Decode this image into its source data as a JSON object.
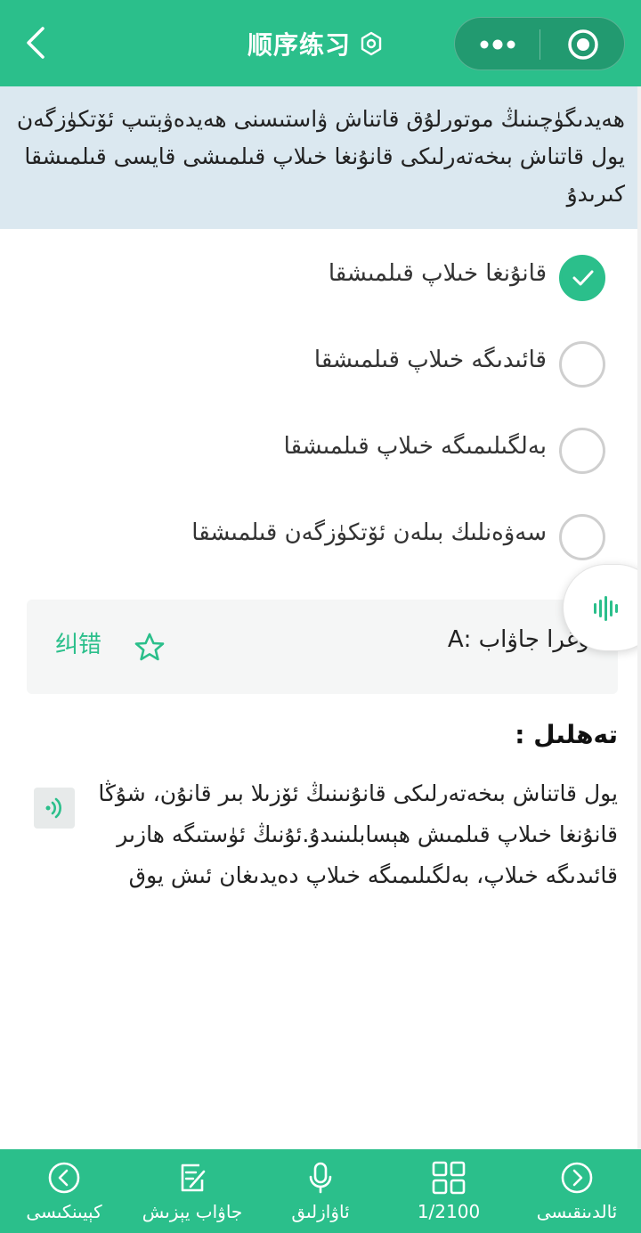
{
  "header": {
    "title": "顺序练习",
    "icons": {
      "back": "chevron-left-icon",
      "settings": "hexagon-gear-icon",
      "more": "more-dots-icon",
      "close": "target-circle-icon"
    }
  },
  "question": {
    "text": "ھەيدىگۈچىنىڭ موتورلۇق قاتناش ۋاستىسنى ھەيدەۋېتىپ ئۆتكۈزگەن يول قاتناش بىخەتەرلىكى قانۇنغا خىلاپ قىلمىشى قايسى قىلمىشقا كىرىدۇ"
  },
  "options": [
    {
      "label": "قانۇنغا خىلاپ قىلمىشقا",
      "checked": true
    },
    {
      "label": "قائىدىگە خىلاپ قىلمىشقا",
      "checked": false
    },
    {
      "label": "بەلگىلىمىگە خىلاپ قىلمىشقا",
      "checked": false
    },
    {
      "label": "سەۋەنلىك بىلەن ئۆتكۈزگەن قىلمىشقا",
      "checked": false
    }
  ],
  "answer": {
    "correction_label": "纠错",
    "answer_text": "توغرا جاۋاب :A"
  },
  "analysis": {
    "title": "تەھلىل :",
    "text": "يول قاتناش بىخەتەرلىكى قانۇنىنىڭ ئۆزىلا بىر قانۇن، شۇڭا قانۇنغا خىلاپ قىلمىش ھېسابلىنىدۇ.ئۇنىڭ ئۈستىگە ھازىر قائىدىگە خىلاپ، بەلگىلىمىگە خىلاپ دەيدىغان ئىش يوق"
  },
  "bottom_bar": [
    {
      "label": "ئالدىنقىسى",
      "icon": "chevron-right-circle-icon"
    },
    {
      "label": "1/2100",
      "icon": "grid-icon"
    },
    {
      "label": "ئاۋازلىق",
      "icon": "microphone-icon"
    },
    {
      "label": "جاۋاب يېزىش",
      "icon": "edit-note-icon"
    },
    {
      "label": "كېيىنكىسى",
      "icon": "chevron-left-circle-icon"
    }
  ],
  "colors": {
    "primary": "#2bbf8b",
    "question_bg": "#dbe8f0",
    "panel_bg": "#f5f6f6"
  }
}
